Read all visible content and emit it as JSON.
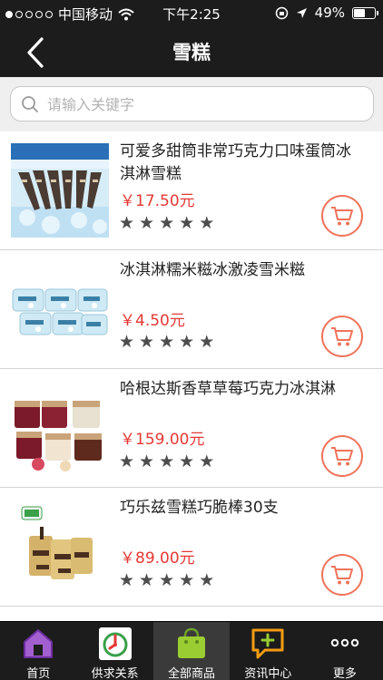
{
  "status_bar": {
    "carrier": "中国移动",
    "time": "下午2:25",
    "battery": "49%",
    "battery_level": 0.49
  },
  "nav": {
    "title": "雪糕"
  },
  "search": {
    "placeholder": "请输入关键字",
    "value": ""
  },
  "products": [
    {
      "name": "可爱多甜筒非常巧克力口味蛋筒冰淇淋雪糕",
      "price": "￥17.50元",
      "rating": 5
    },
    {
      "name": "冰淇淋糯米糍冰激凌雪米糍",
      "price": "￥4.50元",
      "rating": 5
    },
    {
      "name": "哈根达斯香草草莓巧克力冰淇淋",
      "price": "￥159.00元",
      "rating": 5
    },
    {
      "name": "巧乐兹雪糕巧脆棒30支",
      "price": "￥89.00元",
      "rating": 5
    }
  ],
  "tabs": [
    {
      "label": "首页",
      "icon": "home-icon",
      "active": false
    },
    {
      "label": "供求关系",
      "icon": "supply-demand-icon",
      "active": false
    },
    {
      "label": "全部商品",
      "icon": "shopping-bag-icon",
      "active": true
    },
    {
      "label": "资讯中心",
      "icon": "chat-plus-icon",
      "active": false
    },
    {
      "label": "更多",
      "icon": "more-icon",
      "active": false
    }
  ],
  "colors": {
    "bar_bg": "#1c1c1c",
    "price": "#e53935",
    "cart_accent": "#f0735a",
    "home_purple": "#8b4dba",
    "bag_green": "#9acd32",
    "chat_orange": "#f39c12"
  }
}
